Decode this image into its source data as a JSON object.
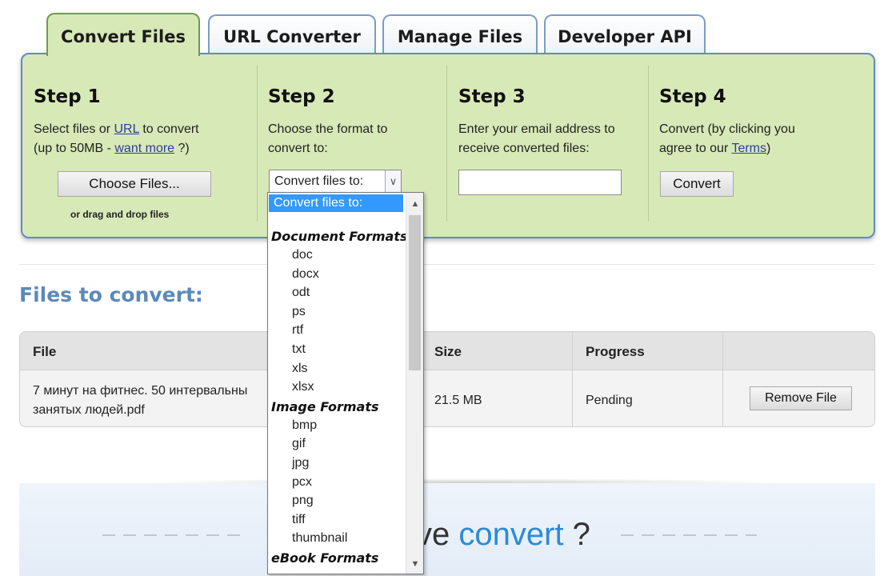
{
  "tabs": [
    {
      "label": "Convert Files",
      "active": true
    },
    {
      "label": "URL Converter",
      "active": false
    },
    {
      "label": "Manage Files",
      "active": false
    },
    {
      "label": "Developer API",
      "active": false
    }
  ],
  "steps": {
    "s1": {
      "title": "Step 1",
      "line1_pre": "Select files or ",
      "url_link": "URL",
      "line1_post": " to convert",
      "line2_pre": "(up to 50MB - ",
      "want_more_link": "want more",
      "line2_post": " ?)",
      "choose_button": "Choose Files...",
      "drag_note": "or drag and drop files"
    },
    "s2": {
      "title": "Step 2",
      "line1": "Choose the format to",
      "line2": "convert to:",
      "select_value": "Convert files to:"
    },
    "s3": {
      "title": "Step 3",
      "line1": "Enter your email address to",
      "line2": "receive converted files:",
      "email_value": ""
    },
    "s4": {
      "title": "Step 4",
      "line1": "Convert (by clicking you",
      "line2_pre": "agree to our ",
      "terms_link": "Terms",
      "line2_post": ")",
      "convert_button": "Convert"
    }
  },
  "files_heading": "Files to convert:",
  "table": {
    "headers": {
      "file": "File",
      "size": "Size",
      "progress": "Progress"
    },
    "row": {
      "file_line1": "7 минут на фитнес. 50 интервальны",
      "file_line2": "занятых людей.pdf",
      "size": "21.5 MB",
      "progress": "Pending",
      "remove_button": "Remove File"
    }
  },
  "banner": {
    "pre": "ve ",
    "accent": "convert",
    "post": " ?"
  },
  "dropdown": {
    "selected": "Convert files to:",
    "groups": [
      {
        "label": "Document Formats",
        "items": [
          "doc",
          "docx",
          "odt",
          "ps",
          "rtf",
          "txt",
          "xls",
          "xlsx"
        ]
      },
      {
        "label": "Image Formats",
        "items": [
          "bmp",
          "gif",
          "jpg",
          "pcx",
          "png",
          "tiff",
          "thumbnail"
        ]
      },
      {
        "label": "eBook Formats",
        "items": []
      }
    ]
  },
  "colors": {
    "panel": "#d8e9b8",
    "panel_border": "#5f8cc0",
    "heading": "#5c8ab8",
    "accent": "#2b8bd6",
    "select_highlight": "#3399ff"
  }
}
